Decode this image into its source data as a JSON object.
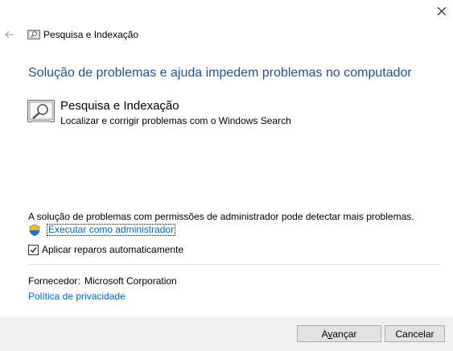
{
  "window": {
    "title": "Pesquisa e Indexação",
    "close_icon": "close-icon",
    "back_icon": "back-arrow-icon"
  },
  "main": {
    "heading": "Solução de problemas e ajuda impedem problemas no computador",
    "tool": {
      "icon": "search-indexing-icon",
      "name": "Pesquisa e Indexação",
      "description": "Localizar e corrigir problemas com o Windows Search"
    },
    "admin_note": "A solução de problemas com permissões de administrador pode detectar mais problemas.",
    "admin_link": "Executar como administrador",
    "auto_repair": {
      "label": "Aplicar reparos automaticamente",
      "checked": true
    },
    "vendor_label": "Fornecedor:",
    "vendor_value": "Microsoft Corporation",
    "privacy_link": "Política de privacidade"
  },
  "footer": {
    "next_label": "Avançar",
    "cancel_label": "Cancelar"
  },
  "colors": {
    "heading": "#1f4e9d",
    "link": "#0066cc",
    "footer_bg": "#f0f0f0"
  }
}
